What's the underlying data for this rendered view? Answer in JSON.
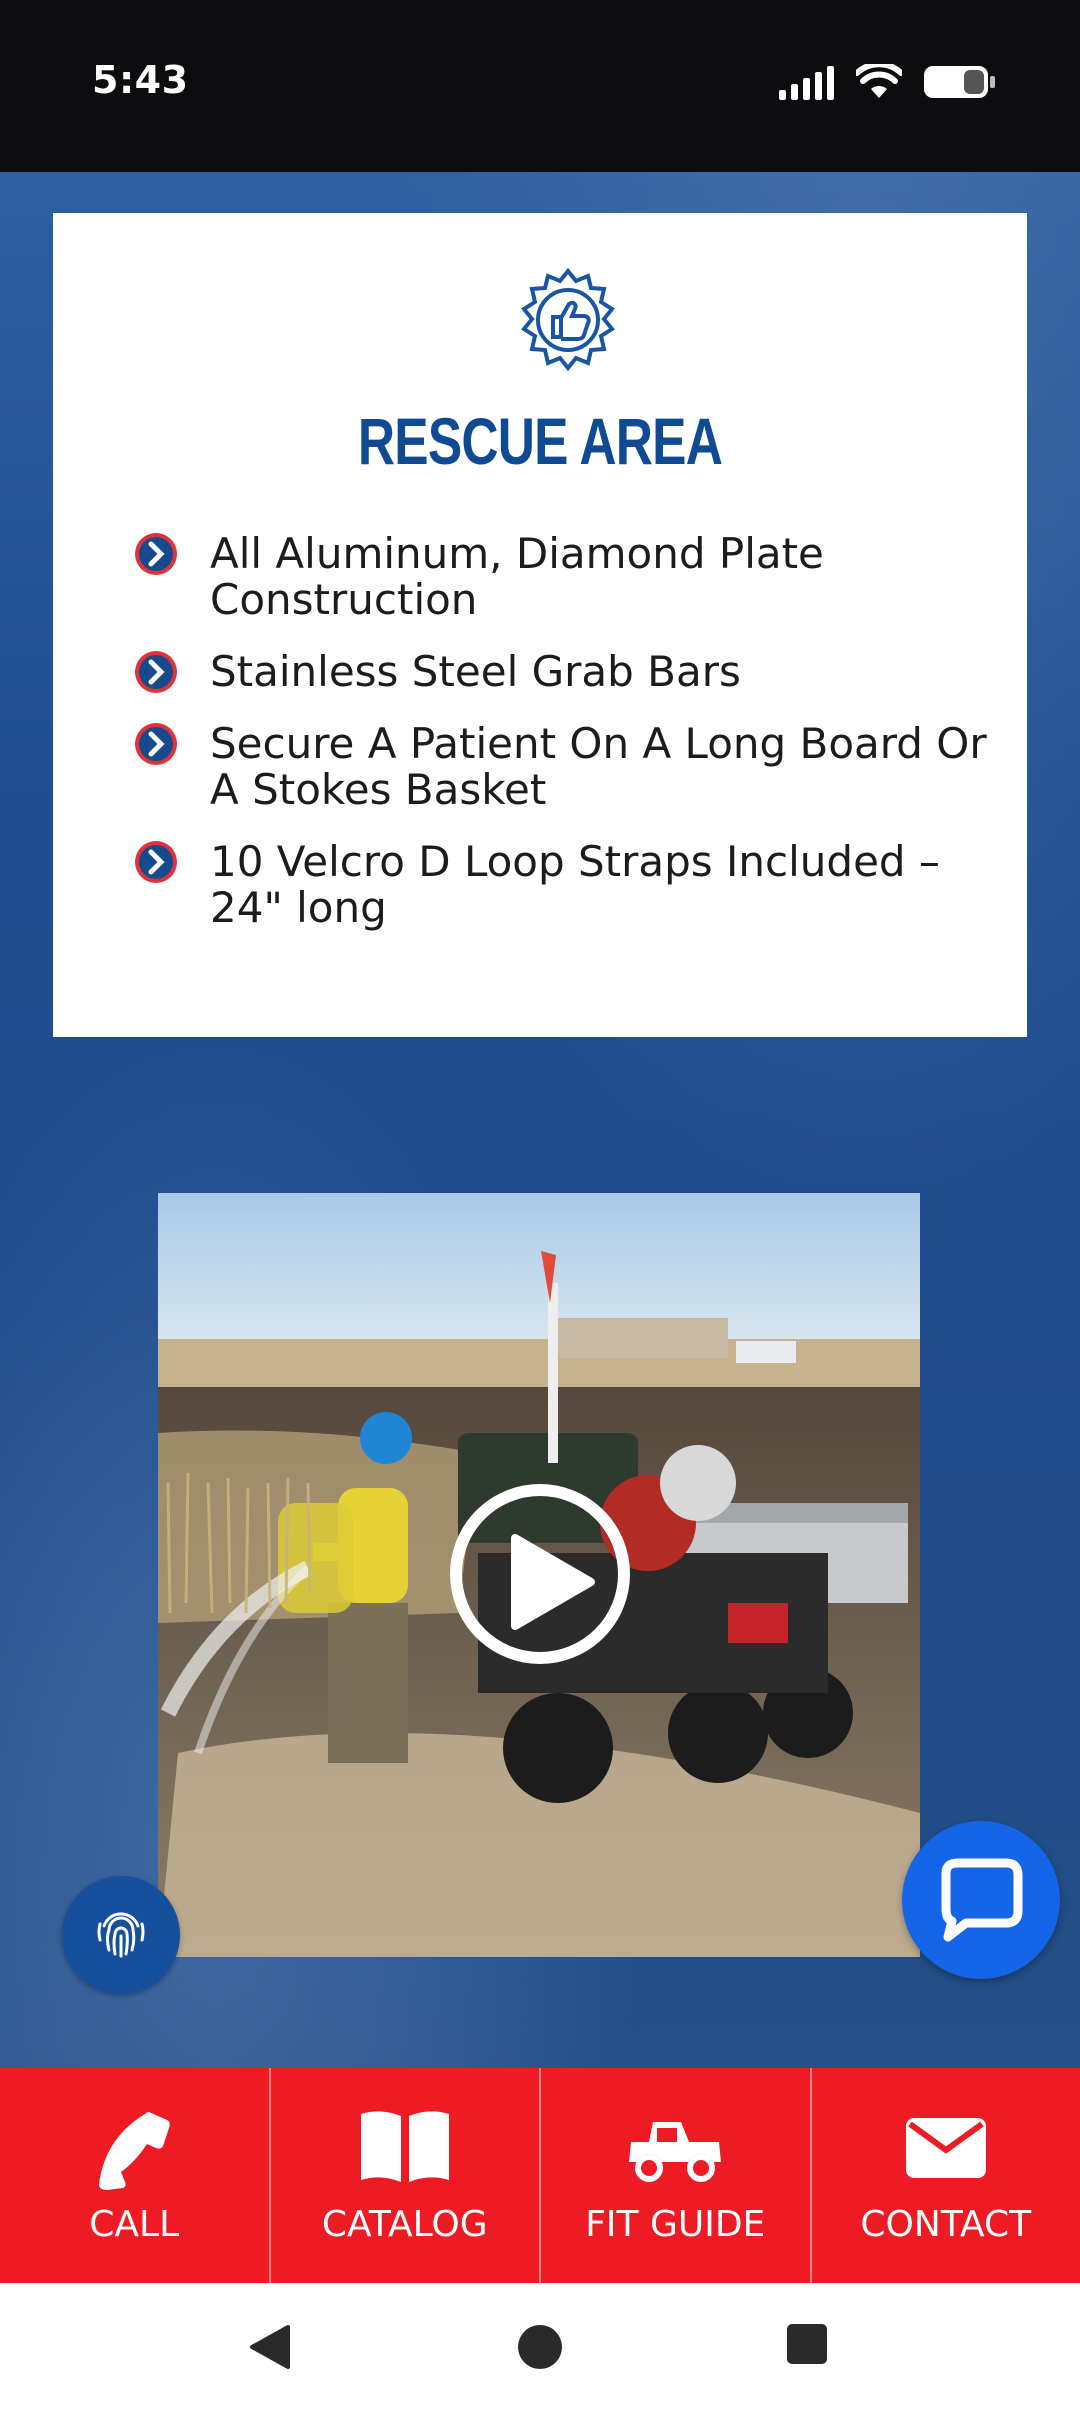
{
  "status_bar": {
    "time": "5:43"
  },
  "card": {
    "title": "RESCUE AREA",
    "badge_icon": "thumbs-up-badge-icon",
    "features": [
      "All Aluminum, Diamond Plate Construction",
      "Stainless Steel Grab Bars",
      "Secure A Patient On A Long Board Or A Stokes Basket",
      "10 Velcro D Loop Straps Included – 24\" long"
    ]
  },
  "video": {
    "thumbnail": "firefighter-spraying-water-beside-utv-with-skid-unit",
    "play_icon": "play-icon"
  },
  "floating": {
    "accessibility_icon": "fingerprint-icon",
    "chat_icon": "chat-bubble-icon"
  },
  "bottom_nav": {
    "items": [
      {
        "label": "CALL",
        "icon": "phone-icon"
      },
      {
        "label": "CATALOG",
        "icon": "open-book-icon"
      },
      {
        "label": "FIT GUIDE",
        "icon": "utv-icon"
      },
      {
        "label": "CONTACT",
        "icon": "envelope-icon"
      }
    ]
  },
  "colors": {
    "title_blue": "#0f4a92",
    "nav_red": "#ee1b24",
    "chat_blue": "#1565e8",
    "bullet_red": "#e0323a"
  }
}
